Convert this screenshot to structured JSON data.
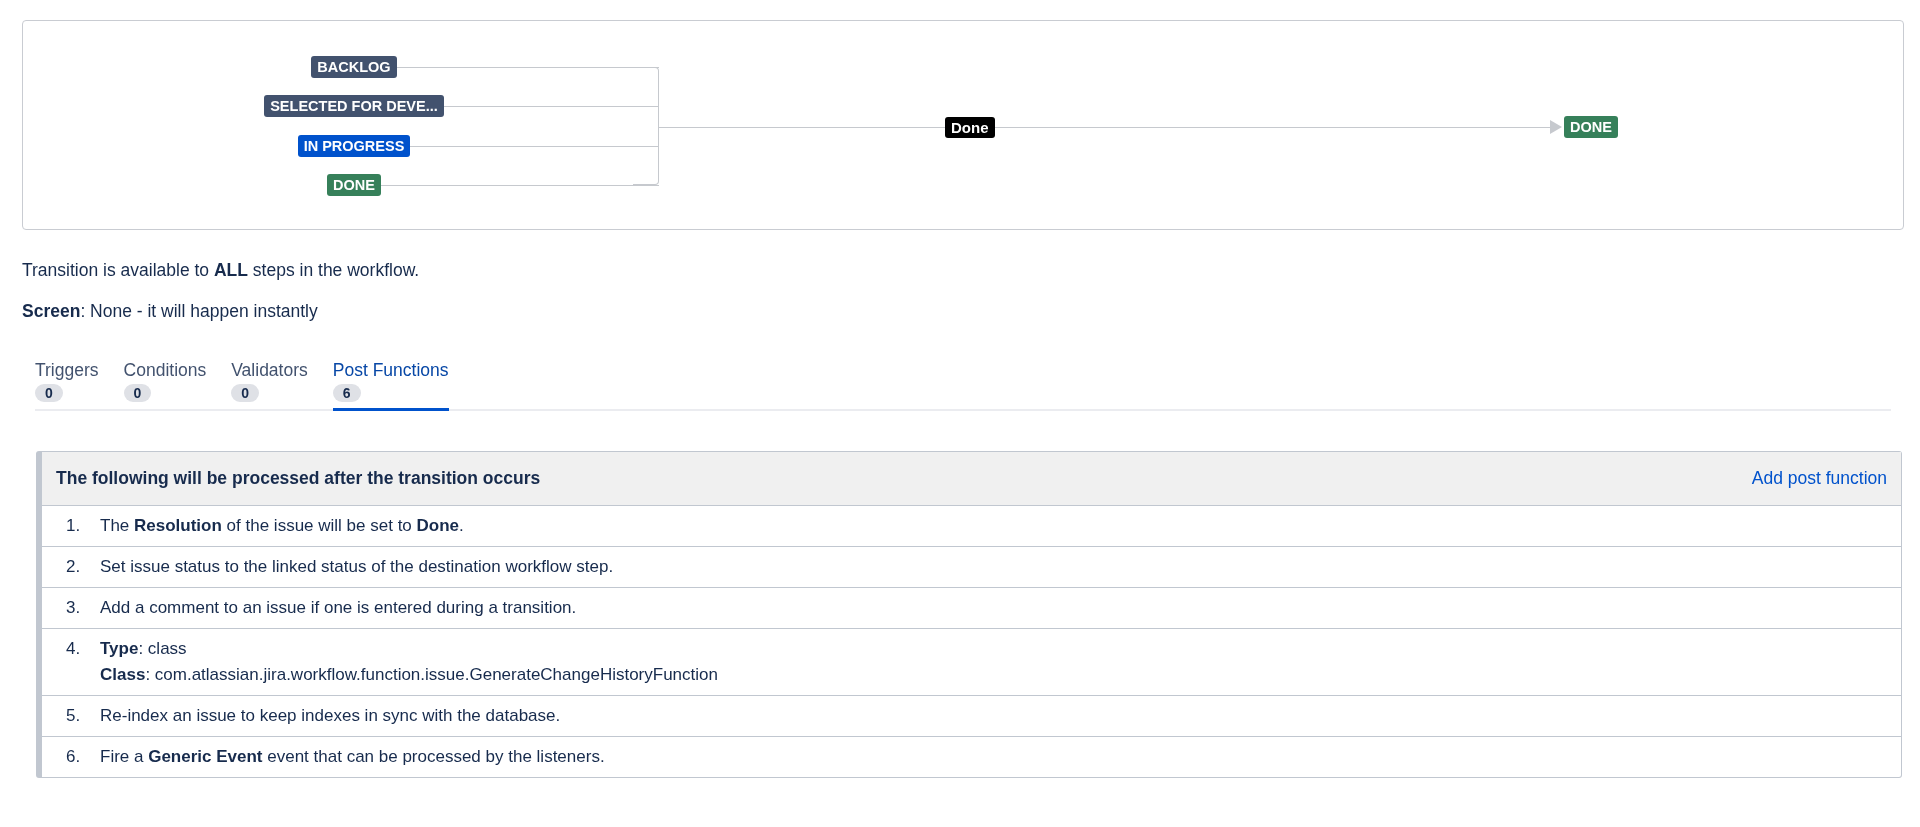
{
  "diagram": {
    "sources": [
      {
        "label": "BACKLOG",
        "color": "#42526e"
      },
      {
        "label": "SELECTED FOR DEVE...",
        "color": "#42526e"
      },
      {
        "label": "IN PROGRESS",
        "color": "#0052cc"
      },
      {
        "label": "DONE",
        "color": "#36805a"
      }
    ],
    "transition": "Done",
    "target": {
      "label": "DONE",
      "color": "#36805a"
    }
  },
  "info": [
    "Transition is available to **ALL** steps in the workflow.",
    "**Screen**: None - it will happen instantly"
  ],
  "tabs": [
    {
      "label": "Triggers",
      "count": "0",
      "selected": false
    },
    {
      "label": "Conditions",
      "count": "0",
      "selected": false
    },
    {
      "label": "Validators",
      "count": "0",
      "selected": false
    },
    {
      "label": "Post Functions",
      "count": "6",
      "selected": true
    }
  ],
  "panel": {
    "title": "The following will be processed after the transition occurs",
    "action": "Add post function",
    "items": [
      {
        "number": "1.",
        "lines": [
          "The **Resolution** of the issue will be set to **Done**."
        ]
      },
      {
        "number": "2.",
        "lines": [
          "Set issue status to the linked status of the destination workflow step."
        ]
      },
      {
        "number": "3.",
        "lines": [
          "Add a comment to an issue if one is entered during a transition."
        ]
      },
      {
        "number": "4.",
        "lines": [
          "**Type**: class",
          "**Class**: com.atlassian.jira.workflow.function.issue.GenerateChangeHistoryFunction"
        ]
      },
      {
        "number": "5.",
        "lines": [
          "Re-index an issue to keep indexes in sync with the database."
        ]
      },
      {
        "number": "6.",
        "lines": [
          "Fire a **Generic Event** event that can be processed by the listeners."
        ]
      }
    ]
  }
}
